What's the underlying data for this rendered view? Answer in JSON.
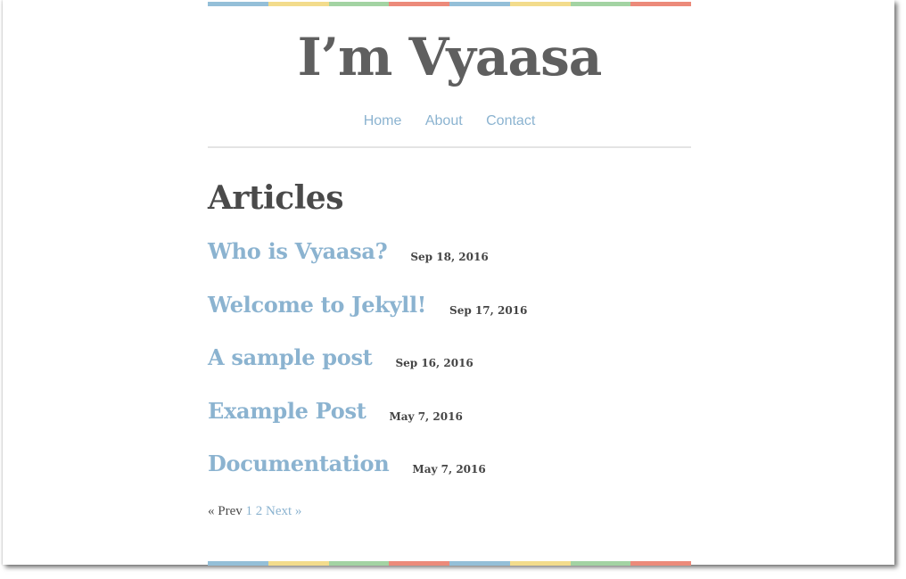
{
  "site": {
    "title": "I’m Vyaasa"
  },
  "nav": {
    "items": [
      {
        "label": "Home"
      },
      {
        "label": "About"
      },
      {
        "label": "Contact"
      }
    ]
  },
  "main": {
    "heading": "Articles",
    "posts": [
      {
        "title": "Who is Vyaasa?",
        "date": "Sep 18, 2016"
      },
      {
        "title": "Welcome to Jekyll!",
        "date": "Sep 17, 2016"
      },
      {
        "title": "A sample post",
        "date": "Sep 16, 2016"
      },
      {
        "title": "Example Post",
        "date": "May 7, 2016"
      },
      {
        "title": "Documentation",
        "date": "May 7, 2016"
      }
    ]
  },
  "pagination": {
    "prev": "« Prev",
    "pages": [
      "1",
      "2"
    ],
    "next": "Next »"
  },
  "colors": {
    "stripe": [
      "#94bfd8",
      "#f3dc8c",
      "#a3d3a3",
      "#ec8a7a",
      "#94bfd8",
      "#f3dc8c",
      "#a3d3a3",
      "#ec8a7a"
    ],
    "link": "#8bb3d0",
    "title": "#5f5f5f"
  }
}
